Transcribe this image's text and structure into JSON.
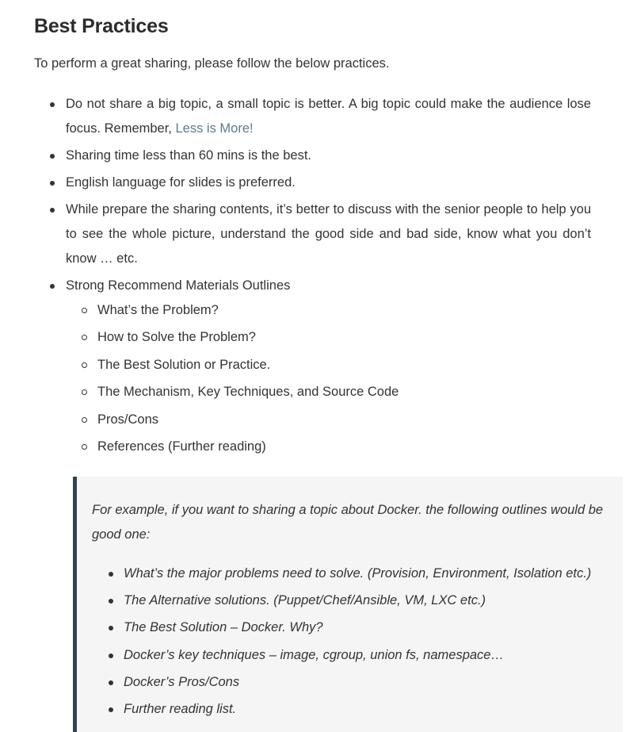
{
  "heading": "Best Practices",
  "intro": "To perform a great sharing, please follow the below practices.",
  "practices": {
    "item1_text": "Do not share a big topic, a small topic is better. A big topic could make the audience lose focus. Remember, ",
    "item1_link": "Less is More!",
    "item2": "Sharing time less than 60 mins is the best.",
    "item3": "English language for slides is preferred.",
    "item4": "While prepare the sharing contents, it’s better to discuss with the senior people to help you to see the whole picture, understand the good side and bad side, know what you don’t know … etc.",
    "item5": "Strong Recommend Materials Outlines",
    "outlines": [
      "What’s the Problem?",
      "How to Solve the Problem?",
      "The Best Solution or Practice.",
      "The Mechanism, Key Techniques, and Source Code",
      "Pros/Cons",
      "References (Further reading)"
    ]
  },
  "example": {
    "intro": "For example, if you want to sharing a topic about Docker. the following outlines would be good one:",
    "items": [
      "What’s the major problems need to solve. (Provision, Environment, Isolation etc.)",
      "The Alternative solutions. (Puppet/Chef/Ansible, VM, LXC etc.)",
      "The Best Solution – Docker. Why?",
      "Docker’s key techniques – image, cgroup, union fs, namespace…",
      "Docker’s Pros/Cons",
      "Further reading list."
    ]
  },
  "colors": {
    "text": "#333333",
    "link": "#5b7a8c",
    "quote_background": "#f5f5f5",
    "quote_border": "#33434e"
  }
}
